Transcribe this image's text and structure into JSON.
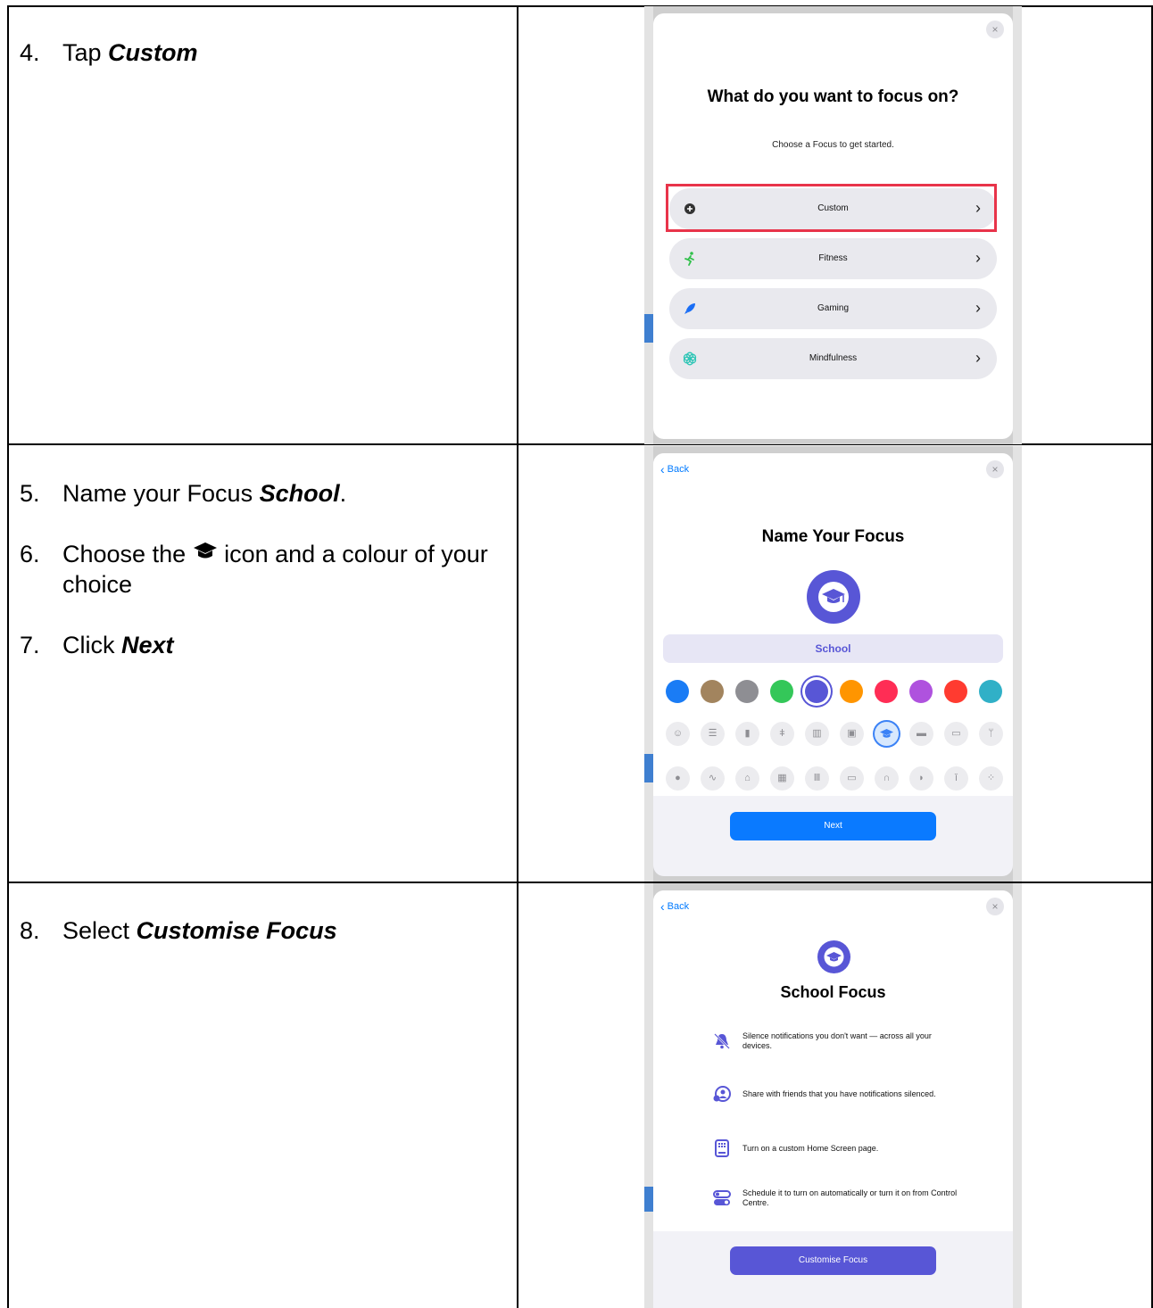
{
  "steps": {
    "s4": {
      "num": "4.",
      "pre": "Tap ",
      "em": "Custom"
    },
    "s5": {
      "num": "5.",
      "pre": "Name your Focus ",
      "em": "School",
      "post": "."
    },
    "s6": {
      "num": "6.",
      "pre": "Choose the ",
      "post": " icon and a colour of your choice"
    },
    "s7": {
      "num": "7.",
      "pre": "Click ",
      "em": "Next"
    },
    "s8": {
      "num": "8.",
      "pre": "Select ",
      "em": "Customise Focus"
    }
  },
  "screen1": {
    "close": "×",
    "title": "What do you want to focus on?",
    "subtitle": "Choose a Focus to get started.",
    "options": [
      {
        "label": "Custom",
        "icon": "plus-circle-icon"
      },
      {
        "label": "Fitness",
        "icon": "running-icon"
      },
      {
        "label": "Gaming",
        "icon": "rocket-icon"
      },
      {
        "label": "Mindfulness",
        "icon": "flower-icon"
      }
    ],
    "highlighted_option": "Custom"
  },
  "screen2": {
    "back": "Back",
    "close": "×",
    "title": "Name Your Focus",
    "name_value": "School",
    "colors": [
      "#1a7cf5",
      "#a2845e",
      "#8e8e93",
      "#34c759",
      "#5856d6",
      "#ff9500",
      "#ff2d55",
      "#af52de",
      "#ff3b30",
      "#30b0c7"
    ],
    "selected_color": "#5856d6",
    "selected_icon": "graduation-cap-icon",
    "next": "Next"
  },
  "screen3": {
    "back": "Back",
    "close": "×",
    "title": "School Focus",
    "features": [
      {
        "icon": "bell-slash-icon",
        "text": "Silence notifications you don't want — across all your devices."
      },
      {
        "icon": "share-status-icon",
        "text": "Share with friends that you have notifications silenced."
      },
      {
        "icon": "home-screen-page-icon",
        "text": "Turn on a custom Home Screen page."
      },
      {
        "icon": "toggle-schedule-icon",
        "text": "Schedule it to turn on automatically or turn it on from Control Centre."
      }
    ],
    "button": "Customise Focus"
  }
}
